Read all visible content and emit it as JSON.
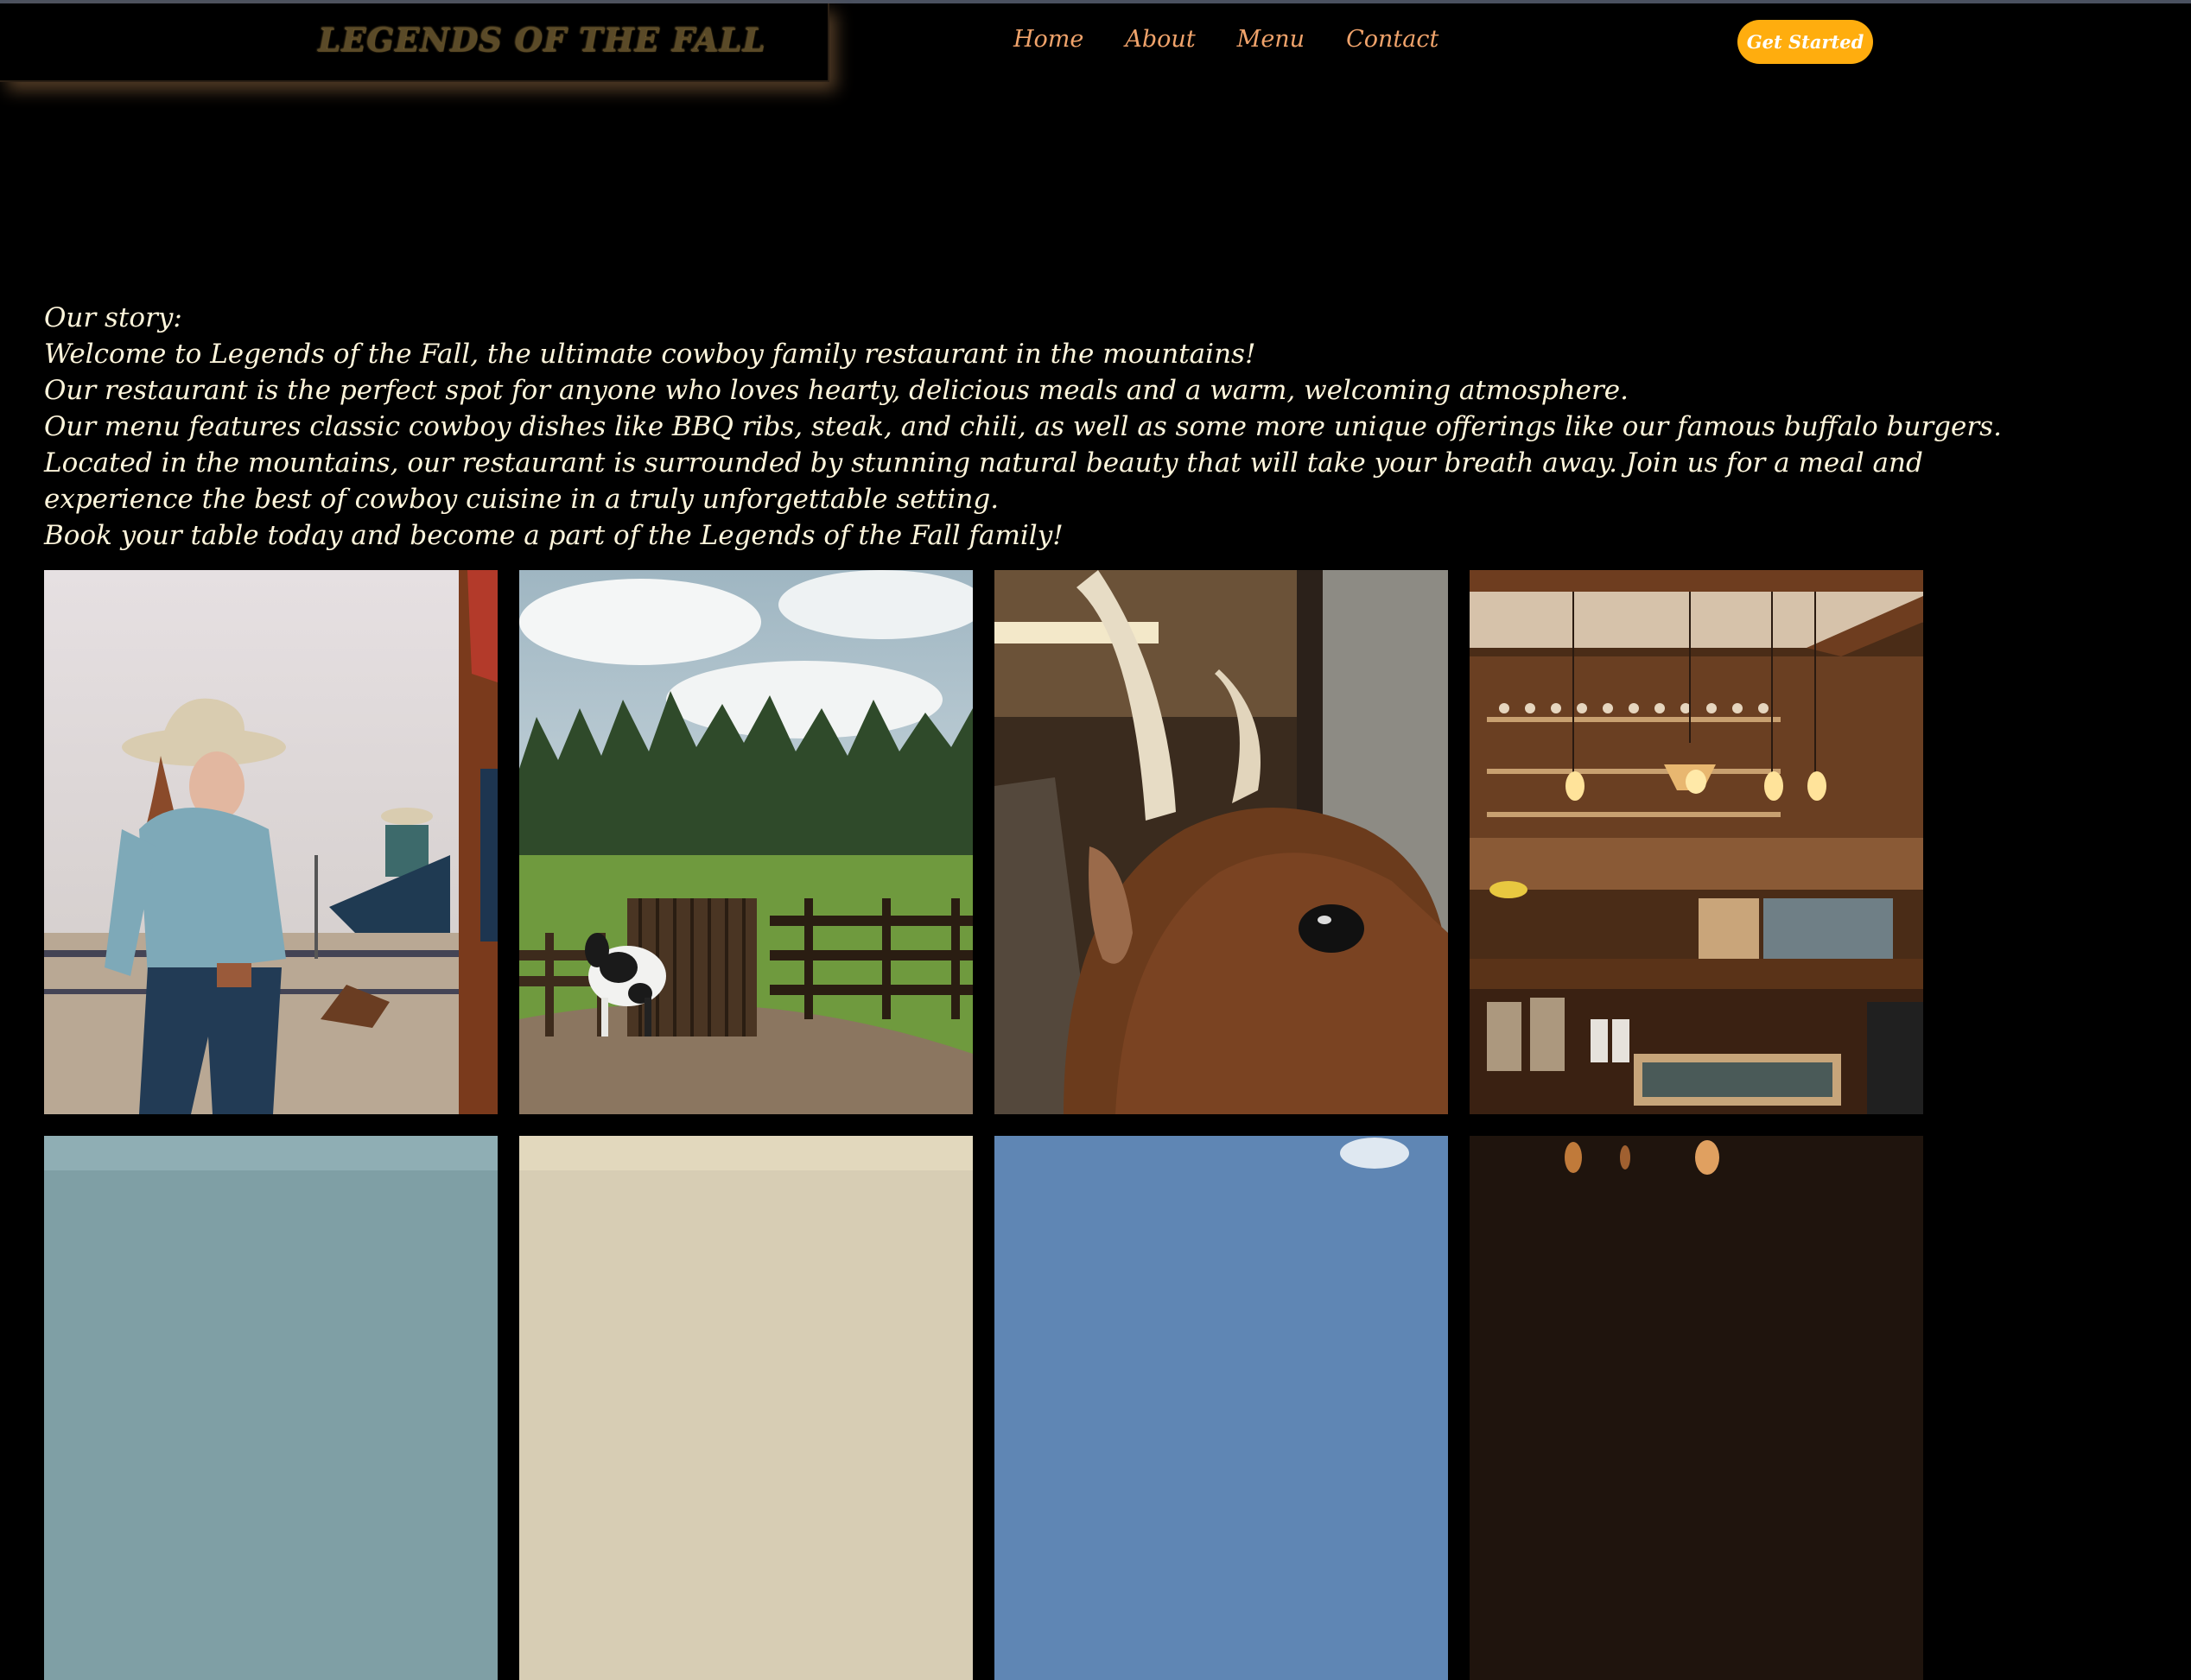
{
  "header": {
    "brand": "LEGENDS OF THE FALL",
    "nav": [
      "Home",
      "About",
      "Menu",
      "Contact"
    ],
    "cta_label": "Get Started"
  },
  "story": {
    "lines": [
      "Our story:",
      "Welcome to Legends of the Fall, the ultimate cowboy family restaurant in the mountains!",
      "Our restaurant is the perfect spot for anyone who loves hearty, delicious meals and a warm, welcoming atmosphere.",
      "Our menu features classic cowboy dishes like BBQ ribs, steak, and chili, as well as some more unique offerings like our famous buffalo burgers.",
      "Located in the mountains, our restaurant is surrounded by stunning natural beauty that will take your breath away. Join us for a meal and experience the best of cowboy cuisine in a truly unforgettable setting.",
      "Book your table today and become a part of the Legends of the Fall family!"
    ]
  },
  "gallery": {
    "images": [
      "cowgirl-photo",
      "pasture-gate-photo",
      "bull-photo",
      "saloon-bar-photo",
      "sky-photo",
      "sand-photo",
      "blue-sky-photo",
      "bar-lights-photo"
    ]
  },
  "colors": {
    "background": "#000000",
    "nav_link": "#f0a36b",
    "cta": "#ffad0e",
    "story_text": "#fff6dc"
  }
}
